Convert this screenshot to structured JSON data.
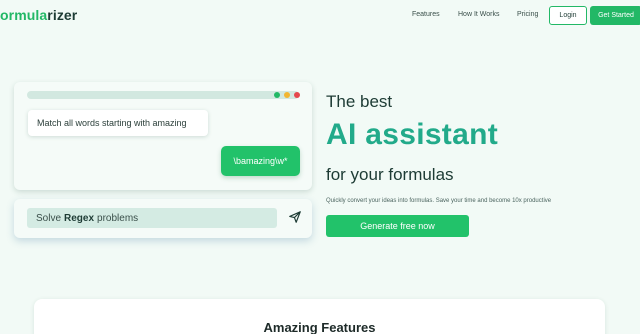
{
  "nav": {
    "logo_part1": "ormula",
    "logo_part2": "rizer",
    "links": [
      "Features",
      "How It Works",
      "Pricing"
    ],
    "login": "Login",
    "get_started": "Get Started"
  },
  "demo": {
    "prompt": "Match all words starting with amazing",
    "reply": "\\bamazing\\w*",
    "window_dots": [
      "#22b866",
      "#f2b632",
      "#e5484d"
    ]
  },
  "input": {
    "before": "Solve",
    "bold": "Regex",
    "after": "problems",
    "send_icon": "paper-plane-icon"
  },
  "hero": {
    "line1": "The best",
    "line2": "AI assistant",
    "line3": "for your formulas",
    "subtitle": "Quickly convert your ideas into formulas. Save your time and become 10x productive",
    "cta": "Generate free now"
  },
  "features": {
    "title": "Amazing Features"
  },
  "colors": {
    "brand_green": "#22b866",
    "accent_teal": "#22aa8a",
    "background": "#f2faf6"
  }
}
